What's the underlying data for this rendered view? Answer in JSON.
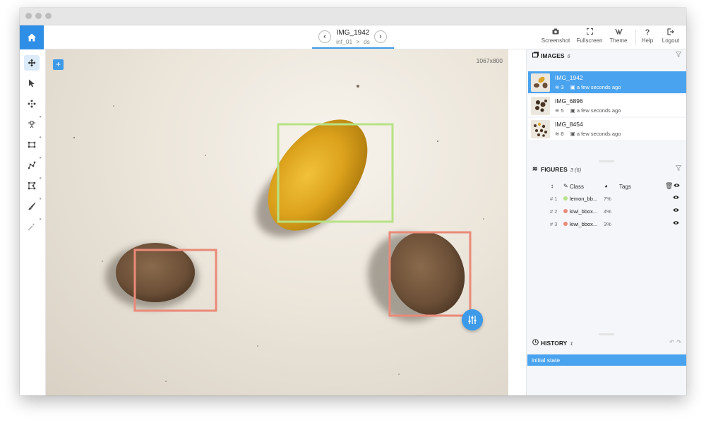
{
  "app": {
    "image_title": "IMG_1942",
    "path_project": "inf_01",
    "path_separator": ">",
    "path_dataset": "ds",
    "toolbar": {
      "screenshot": "Screenshot",
      "fullscreen": "Fullscreen",
      "theme": "Theme",
      "help": "Help",
      "logout": "Logout"
    }
  },
  "canvas": {
    "image_size": "1067x800",
    "add_button": "+"
  },
  "tools": [
    "move-tool",
    "select-tool",
    "points-tool",
    "point-tool",
    "rectangle-tool",
    "polyline-tool",
    "polygon-tool",
    "brush-tool",
    "smart-tool"
  ],
  "images": {
    "title": "IMAGES",
    "count": "6",
    "items": [
      {
        "name": "IMG_1942",
        "figures": "3",
        "time": "a few seconds ago"
      },
      {
        "name": "IMG_6896",
        "figures": "5",
        "time": "a few seconds ago"
      },
      {
        "name": "IMG_8454",
        "figures": "8",
        "time": "a few seconds ago"
      }
    ]
  },
  "figures": {
    "title": "FIGURES",
    "count": "3 (6)",
    "col_class": "Class",
    "col_tags": "Tags",
    "rows": [
      {
        "num": "# 1",
        "class": "lemon_bb...",
        "area": "7%",
        "color": "#b7e286"
      },
      {
        "num": "# 2",
        "class": "kiwi_bbox...",
        "area": "4%",
        "color": "#ea8a78"
      },
      {
        "num": "# 3",
        "class": "kiwi_bbox...",
        "area": "3%",
        "color": "#ea8a78"
      }
    ]
  },
  "history": {
    "title": "HISTORY",
    "count": "1",
    "items": [
      "initial state"
    ]
  },
  "colors": {
    "accent": "#3d9ae8",
    "lemon_box": "#b7e286",
    "kiwi_box": "#ea8a78"
  }
}
